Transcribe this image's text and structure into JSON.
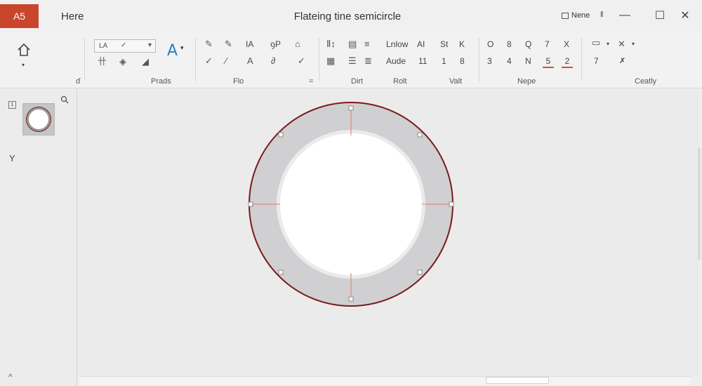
{
  "titlebar": {
    "app_badge": "A5",
    "tab_home": "Here",
    "doc_title": "Flateing tine semicircle",
    "share_label": "Nene",
    "pin_glyph": "‖",
    "minimize_glyph": "—",
    "maximize_glyph": "☐",
    "close_glyph": "✕"
  },
  "ribbon": {
    "home_icon_caret": "▾",
    "font_name": "LA",
    "font_check": "✓",
    "font_dd": "▾",
    "big_a": "A",
    "big_a_dd": "▾",
    "row1_left": [
      "ꟷ",
      "◢",
      "⌐"
    ],
    "left_small": [
      "卄",
      "◈",
      "◢"
    ],
    "draw_row1": [
      "✎",
      "✎",
      "IA",
      "ꝯP",
      "⌂"
    ],
    "draw_row2": [
      "✓",
      "∕",
      "A",
      "∂",
      "✓"
    ],
    "para_row1": [
      "Ⅱ↕",
      "▤",
      "≡"
    ],
    "para_row2": [
      "▦",
      "☰",
      "≣"
    ],
    "text_row1": [
      "Lnlow",
      "AI",
      "St",
      "K"
    ],
    "text_row2": [
      "Aude",
      "11",
      "1",
      "8"
    ],
    "num_row1": [
      "O",
      "8",
      "Q",
      "7",
      "X"
    ],
    "num_row2": [
      "3",
      "4",
      "N",
      "5",
      "2"
    ],
    "right_row1": [
      "▭",
      "✕"
    ],
    "right_row2": [
      "7",
      "✗"
    ],
    "groups": {
      "g0": "ɗ",
      "g1": "Prads",
      "g2": "Flo",
      "g3": "=",
      "g4": "Dirt",
      "g5": "Rolt",
      "g6": "Valt",
      "g7": "Nepe",
      "g8": "Ceatly"
    }
  },
  "left_pane": {
    "slide_number": "1",
    "y_label": "Y",
    "collapse_glyph": "^"
  },
  "colors": {
    "accent": "#c9452c",
    "ring_fill": "#d0d0d2",
    "ring_stroke": "#7a1a1a",
    "guide": "#d9826a"
  }
}
